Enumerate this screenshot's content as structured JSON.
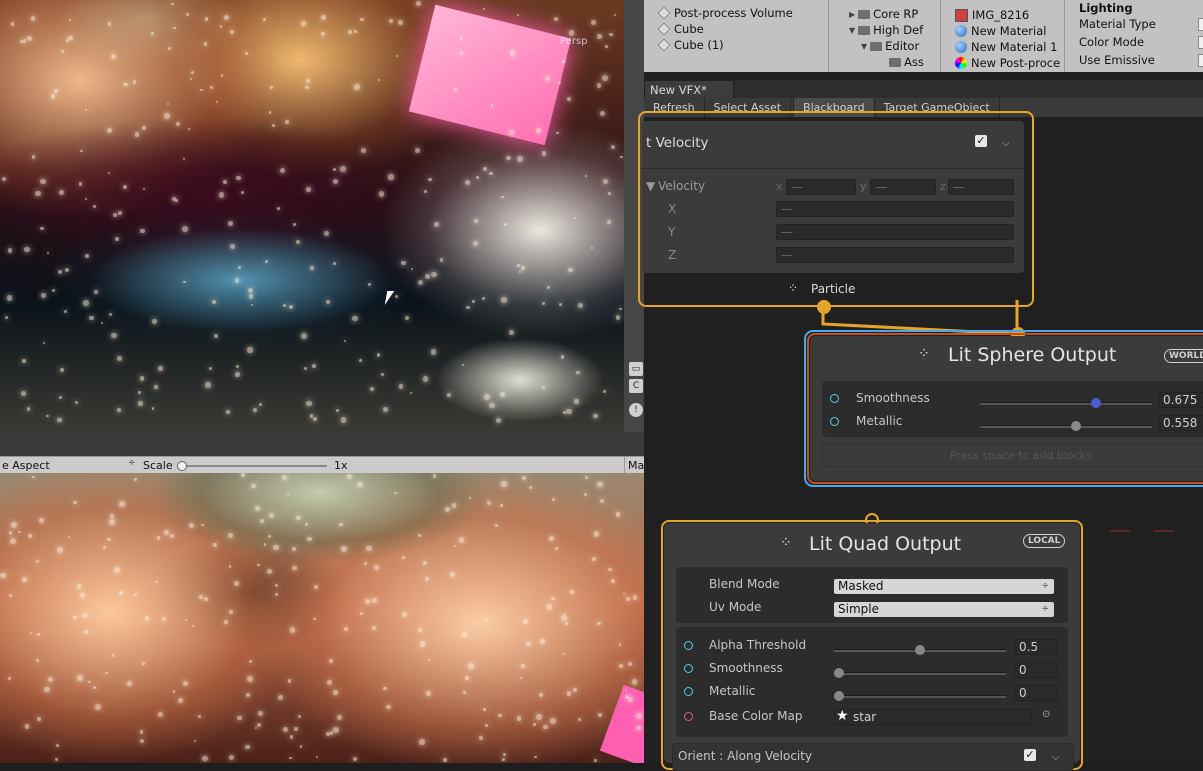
{
  "hierarchy": {
    "items": [
      "Post-process Volume",
      "Cube",
      "Cube (1)"
    ]
  },
  "project": {
    "folders": [
      {
        "label": "Core RP",
        "depth": 1
      },
      {
        "label": "High Def",
        "depth": 1
      },
      {
        "label": "Editor",
        "depth": 2
      },
      {
        "label": "Ass",
        "depth": 3
      }
    ],
    "assets": [
      "IMG_8216",
      "New Material",
      "New Material 1",
      "New Post-proce"
    ]
  },
  "inspector": {
    "section": "Lighting",
    "rows": [
      "Material Type",
      "Color Mode",
      "Use Emissive"
    ]
  },
  "scene": {
    "persp_label": "Persp"
  },
  "game_toolbar": {
    "aspect": "e Aspect",
    "scale_label": "Scale",
    "scale_value": "1x",
    "maximize": "Ma"
  },
  "vfx": {
    "tab": "New VFX*",
    "toolbar": [
      "Refresh",
      "Select Asset",
      "Blackboard",
      "Target GameObject"
    ],
    "set_velocity": {
      "title": "t Velocity",
      "enabled": true,
      "field_label": "Velocity",
      "axes": [
        "x",
        "y",
        "z"
      ],
      "components": [
        "X",
        "Y",
        "Z"
      ],
      "empty_value": "—"
    },
    "particle_label": "Particle",
    "lit_sphere": {
      "title": "Lit Sphere Output",
      "space_badge": "WORLD",
      "params": [
        {
          "label": "Smoothness",
          "value": "0.675",
          "fraction": 0.7
        },
        {
          "label": "Metallic",
          "value": "0.558",
          "fraction": 0.55
        }
      ],
      "hint": "Press space to add blocks"
    },
    "lit_quad": {
      "title": "Lit Quad Output",
      "space_badge": "LOCAL",
      "blend_mode_label": "Blend Mode",
      "blend_mode_value": "Masked",
      "uv_mode_label": "Uv Mode",
      "uv_mode_value": "Simple",
      "params": [
        {
          "label": "Alpha Threshold",
          "value": "0.5",
          "fraction": 0.5
        },
        {
          "label": "Smoothness",
          "value": "0",
          "fraction": 0.0
        },
        {
          "label": "Metallic",
          "value": "0",
          "fraction": 0.0
        }
      ],
      "base_color_label": "Base Color Map",
      "base_color_value": "star",
      "orient_block": "Orient : Along Velocity",
      "orient_enabled": true
    }
  },
  "colors": {
    "context_border": "#e5a52d",
    "selection_border": "#4aa8e8",
    "port_float": "#4fd0e8",
    "port_texture": "#e2568c",
    "node_bg": "#3b3b3b"
  }
}
